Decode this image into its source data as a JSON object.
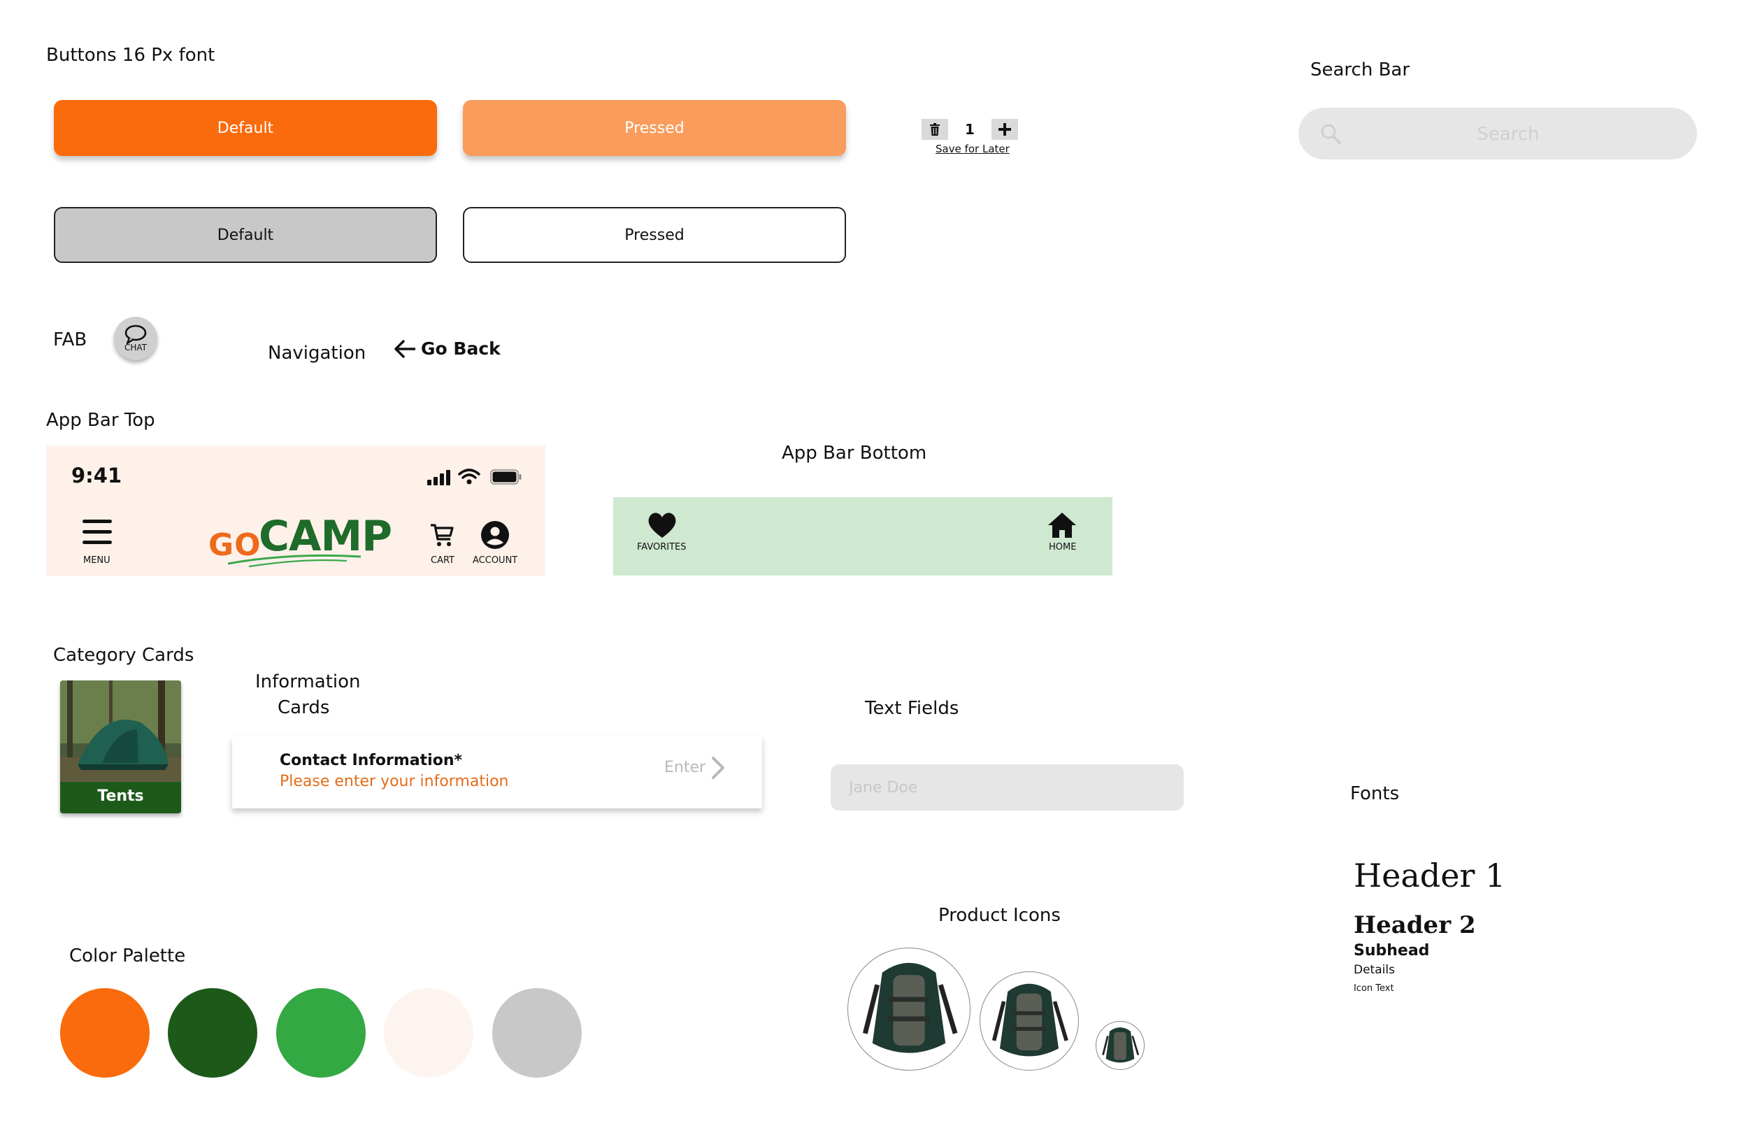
{
  "buttons_section": {
    "title": "Buttons 16 Px font",
    "primary_default": "Default",
    "primary_pressed": "Pressed",
    "secondary_default": "Default",
    "secondary_pressed": "Pressed"
  },
  "stepper": {
    "value": "1",
    "save_label": "Save for Later"
  },
  "search_section": {
    "title": "Search Bar",
    "placeholder": "Search"
  },
  "fab_section": {
    "title": "FAB",
    "chat_label": "CHAT"
  },
  "navigation_section": {
    "title": "Navigation",
    "go_back": "Go Back"
  },
  "app_bar_top": {
    "title": "App Bar Top",
    "time": "9:41",
    "menu_label": "MENU",
    "logo_go": "GO",
    "logo_camp": "CAMP",
    "cart_label": "CART",
    "account_label": "ACCOUNT"
  },
  "app_bar_bottom": {
    "title": "App Bar Bottom",
    "favorites_label": "FAVORITES",
    "home_label": "HOME"
  },
  "category_cards": {
    "title": "Category Cards",
    "tents_label": "Tents"
  },
  "information_cards": {
    "title_line1": "Information",
    "title_line2": "Cards",
    "heading": "Contact Information*",
    "subtitle": "Please enter your information",
    "action": "Enter"
  },
  "text_fields": {
    "title": "Text Fields",
    "placeholder": "Jane Doe"
  },
  "fonts": {
    "title": "Fonts",
    "header1": "Header 1",
    "header2": "Header 2",
    "subhead": "Subhead",
    "details": "Details",
    "icon_text": "Icon Text"
  },
  "product_icons": {
    "title": "Product Icons"
  },
  "color_palette": {
    "title": "Color Palette",
    "colors": [
      "#f96b0c",
      "#1d5a1a",
      "#33a843",
      "#fdf4ef",
      "#c8c8c8"
    ]
  },
  "icons": [
    "trash-icon",
    "plus-icon",
    "search-icon",
    "chat-icon",
    "arrow-left-icon",
    "menu-icon",
    "cart-icon",
    "account-icon",
    "heart-icon",
    "home-icon",
    "chevron-right-icon",
    "signal-icon",
    "wifi-icon",
    "battery-icon"
  ]
}
